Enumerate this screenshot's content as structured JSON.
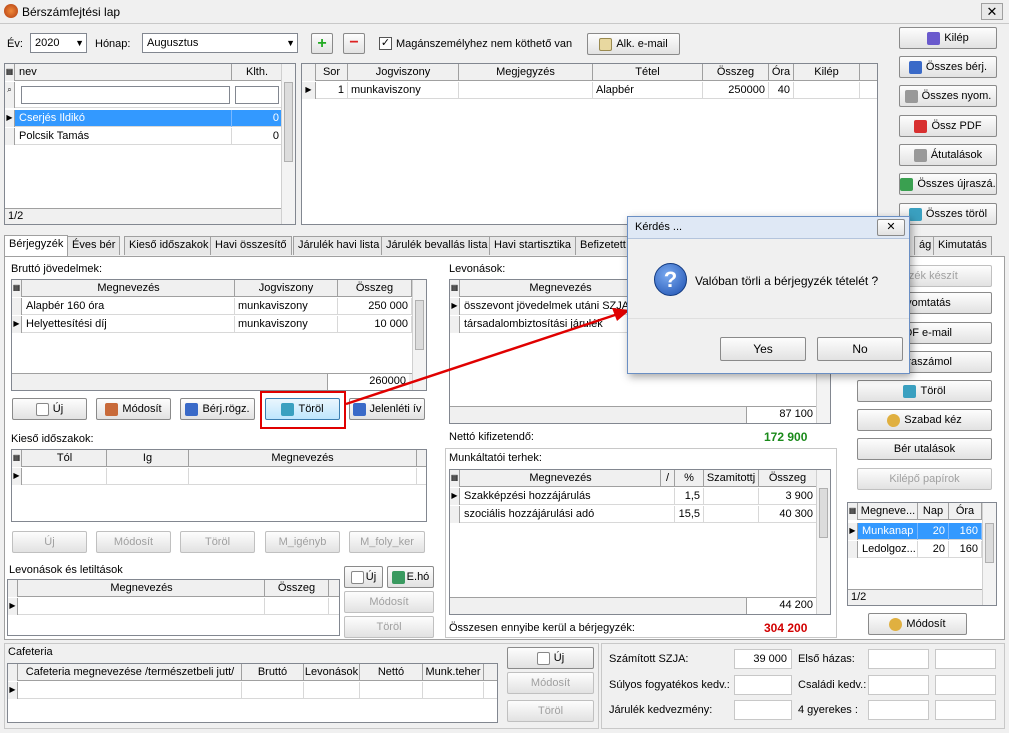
{
  "window": {
    "title": "Bérszámfejtési lap",
    "close": "✕"
  },
  "top": {
    "year_label": "Év:",
    "year": "2020",
    "month_label": "Hónap:",
    "month": "Augusztus",
    "private_checkbox_label": "Magánszemélyhez nem köthető van",
    "email_button": "Alk. e-mail"
  },
  "employees": {
    "columns": [
      "nev",
      "Klth."
    ],
    "rows": [
      {
        "name": "Cserjés Ildikó",
        "klth": "0"
      },
      {
        "name": "Polcsik Tamás",
        "klth": "0"
      }
    ],
    "footer": "1/2"
  },
  "items": {
    "columns": [
      "Sor",
      "Jogviszony",
      "Megjegyzés",
      "Tétel",
      "Összeg",
      "Óra",
      "Kilép"
    ],
    "rows": [
      {
        "sor": "1",
        "jogviszony": "munkaviszony",
        "megjegyzes": "",
        "tetel": "Alapbér",
        "osszeg": "250000",
        "ora": "40",
        "kilep": ""
      }
    ]
  },
  "right_buttons": [
    "Kilép",
    "Összes bérj.",
    "Összes nyom.",
    "Össz PDF",
    "Átutalások",
    "Összes újraszá.",
    "Összes töröl"
  ],
  "tabs": [
    "Bérjegyzék",
    "Éves bér",
    "Kieső időszakok",
    "Havi összesítő",
    "Járulék havi lista",
    "Járulék bevallás lista",
    "Havi startisztika",
    "Befizetett",
    "ág",
    "Kimutatás"
  ],
  "brutto": {
    "title": "Bruttó jövedelmek:",
    "columns": [
      "Megnevezés",
      "Jogviszony",
      "Összeg"
    ],
    "rows": [
      {
        "megnevezes": "Alapbér 160 óra",
        "jogviszony": "munkaviszony",
        "osszeg": "250 000"
      },
      {
        "megnevezes": "Helyettesítési díj",
        "jogviszony": "munkaviszony",
        "osszeg": "10 000"
      }
    ],
    "total": "260000",
    "buttons": [
      "Új",
      "Módosít",
      "Bérj.rögz.",
      "Töröl",
      "Jelenléti ív"
    ]
  },
  "kieso": {
    "title": "Kieső időszakok:",
    "columns": [
      "Tól",
      "Ig",
      "Megnevezés"
    ],
    "buttons": [
      "Új",
      "Módosít",
      "Töröl",
      "M_igényb",
      "M_foly_ker"
    ]
  },
  "levonasok_letiltasok": {
    "title": "Levonások és letiltások",
    "columns": [
      "Megnevezés",
      "Összeg"
    ],
    "buttons": [
      "Új",
      "E.hó",
      "Módosít",
      "Töröl"
    ]
  },
  "levonasok": {
    "title": "Levonások:",
    "columns": [
      "Megnevezés"
    ],
    "rows": [
      "összevont jövedelmek utáni SZJA",
      "társadalombiztosítási járulék"
    ],
    "total": "87 100",
    "netto_label": "Nettó kifizetendő:",
    "netto": "172 900"
  },
  "munkaltatoi": {
    "title": "Munkáltatói terhek:",
    "columns": [
      "Megnevezés",
      "/",
      "%",
      "Szamitottj",
      "Összeg"
    ],
    "rows": [
      {
        "megnevezes": "Szakképzési hozzájárulás",
        "pct": "1,5",
        "osszeg": "3 900"
      },
      {
        "megnevezes": "szociális hozzájárulási adó",
        "pct": "15,5",
        "osszeg": "40 300"
      }
    ],
    "total": "44 200",
    "sum_label": "Összesen ennyibe kerül a bérjegyzék:",
    "sum": "304 200"
  },
  "right_panel": {
    "buttons": [
      "egyzék készít",
      "Nyomtatás",
      "PDF e-mail",
      "Újraszámol",
      "Töröl",
      "Szabad kéz",
      "Bér utalások",
      "Kilépő papírok"
    ],
    "columns": [
      "Megneve...",
      "Nap",
      "Óra"
    ],
    "rows": [
      {
        "name": "Munkanap",
        "nap": "20",
        "ora": "160"
      },
      {
        "name": "Ledolgoz...",
        "nap": "20",
        "ora": "160"
      }
    ],
    "footer": "1/2",
    "modify": "Módosít"
  },
  "cafeteria": {
    "title": "Cafeteria",
    "columns": [
      "Cafeteria megnevezése /természetbeli jutt/",
      "Bruttó",
      "Levonások",
      "Nettó",
      "Munk.teher"
    ],
    "buttons": [
      "Új",
      "Módosít",
      "Töröl"
    ]
  },
  "summary": {
    "szja_label": "Számított SZJA:",
    "szja": "39 000",
    "elso_hazas": "Első házas:",
    "sulyos": "Súlyos fogyatékos kedv.:",
    "csaladi": "Családi kedv.:",
    "jarulek": "Járulék kedvezmény:",
    "gyerekes": "4 gyerekes :"
  },
  "dialog": {
    "title": "Kérdés ...",
    "message": "Valóban törli a bérjegyzék tételét ?",
    "yes": "Yes",
    "no": "No"
  },
  "colors": {
    "highlight": "#e00000",
    "selection": "#3399ff",
    "netto_green": "#1a8a1a",
    "sum_red": "#d20000"
  }
}
